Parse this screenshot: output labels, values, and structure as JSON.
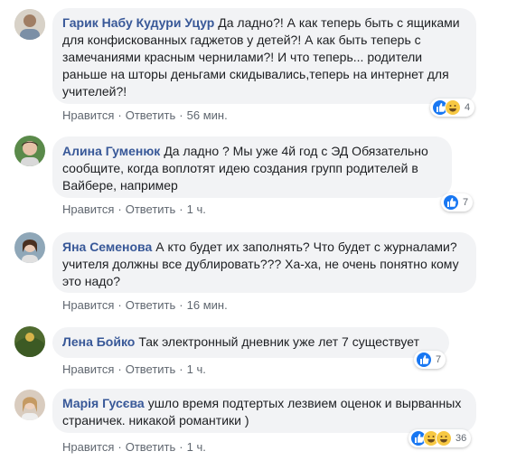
{
  "colors": {
    "author": "#385898",
    "bubble": "#f2f3f5",
    "meta": "#606770",
    "like_blue": "#1877f2",
    "haha_yellow": "#f7c843"
  },
  "comments": [
    {
      "author": "Гарик Набу Кудури Уцур",
      "text": "Да ладно?! А как теперь быть с ящиками для конфискованных гаджетов у детей?! А как быть теперь с замечаниями красным чернилами?! И что теперь... родители раньше на шторы деньгами скидывались,теперь на интернет для учителей?!",
      "like_label": "Нравится",
      "reply_label": "Ответить",
      "time": "56 мин.",
      "reactions": [
        "like-icon",
        "haha-icon"
      ],
      "reaction_count": "4"
    },
    {
      "author": "Алина Гуменюк",
      "text": "Да ладно ? Мы уже 4й год с ЭД Обязательно сообщите, когда воплотят идею создания групп родителей в Вайбере, например",
      "like_label": "Нравится",
      "reply_label": "Ответить",
      "time": "1 ч.",
      "reactions": [
        "like-icon"
      ],
      "reaction_count": "7"
    },
    {
      "author": "Яна Семенова",
      "text": "А кто будет их заполнять? Что будет с журналами? учителя должны все дублировать??? Ха-ха, не очень понятно кому это надо?",
      "like_label": "Нравится",
      "reply_label": "Ответить",
      "time": "16 мин.",
      "reactions": [],
      "reaction_count": ""
    },
    {
      "author": "Лена Бойко",
      "text": "Так электронный дневник уже лет 7 существует",
      "like_label": "Нравится",
      "reply_label": "Ответить",
      "time": "1 ч.",
      "reactions": [
        "like-icon"
      ],
      "reaction_count": "7"
    },
    {
      "author": "Марія Гусєва",
      "text": "ушло время подтертых лезвием оценок и вырванных страничек. никакой романтики )",
      "like_label": "Нравится",
      "reply_label": "Ответить",
      "time": "1 ч.",
      "reactions": [
        "like-icon",
        "haha-icon",
        "haha-icon"
      ],
      "reaction_count": "36"
    }
  ]
}
